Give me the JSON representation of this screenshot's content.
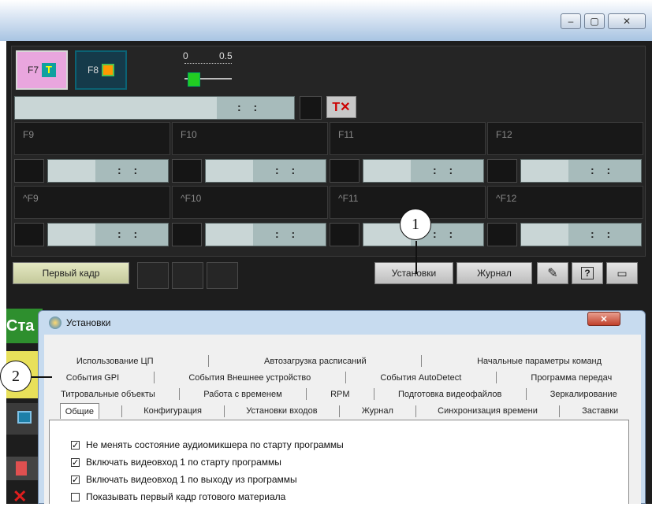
{
  "app": {
    "window_controls": {
      "minimize": "–",
      "maximize": "▢",
      "close": "✕"
    },
    "fkeys": [
      {
        "label": "F7"
      },
      {
        "label": "F8"
      }
    ],
    "slider": {
      "min_label": "0",
      "max_label": "0.5",
      "value": 0
    },
    "timer_text": ": :",
    "slots_row1": [
      {
        "label": "F9"
      },
      {
        "label": "F10"
      },
      {
        "label": "F11"
      },
      {
        "label": "F12"
      }
    ],
    "slots_row2": [
      {
        "label": "^F9"
      },
      {
        "label": "^F10"
      },
      {
        "label": "^F11"
      },
      {
        "label": "^F12"
      }
    ],
    "first_frame_button": "Первый кадр",
    "settings_button": "Установки",
    "log_button": "Журнал",
    "partial_left_text": "Ста"
  },
  "dialog": {
    "title": "Установки",
    "close": "✕",
    "tabs_row1": [
      "Использование ЦП",
      "Автозагрузка расписаний",
      "Начальные параметры команд"
    ],
    "tabs_row2": [
      "События GPI",
      "События Внешнее устройство",
      "События AutoDetect",
      "Программа передач"
    ],
    "tabs_row3": [
      "Титровальные объекты",
      "Работа с временем",
      "RPM",
      "Подготовка видеофайлов",
      "Зеркалирование"
    ],
    "tabs_row4": [
      "Общие",
      "Конфигурация",
      "Установки входов",
      "Журнал",
      "Синхронизация времени",
      "Заставки"
    ],
    "options": [
      {
        "label": "Не менять состояние аудиомикшера по старту программы",
        "checked": true
      },
      {
        "label": "Включать видеовход 1 по старту программы",
        "checked": true
      },
      {
        "label": "Включать видеовход 1 по выходу из программы",
        "checked": true
      },
      {
        "label": "Показывать первый кадр готового материала",
        "checked": false
      }
    ]
  },
  "callouts": {
    "one": "1",
    "two": "2"
  }
}
